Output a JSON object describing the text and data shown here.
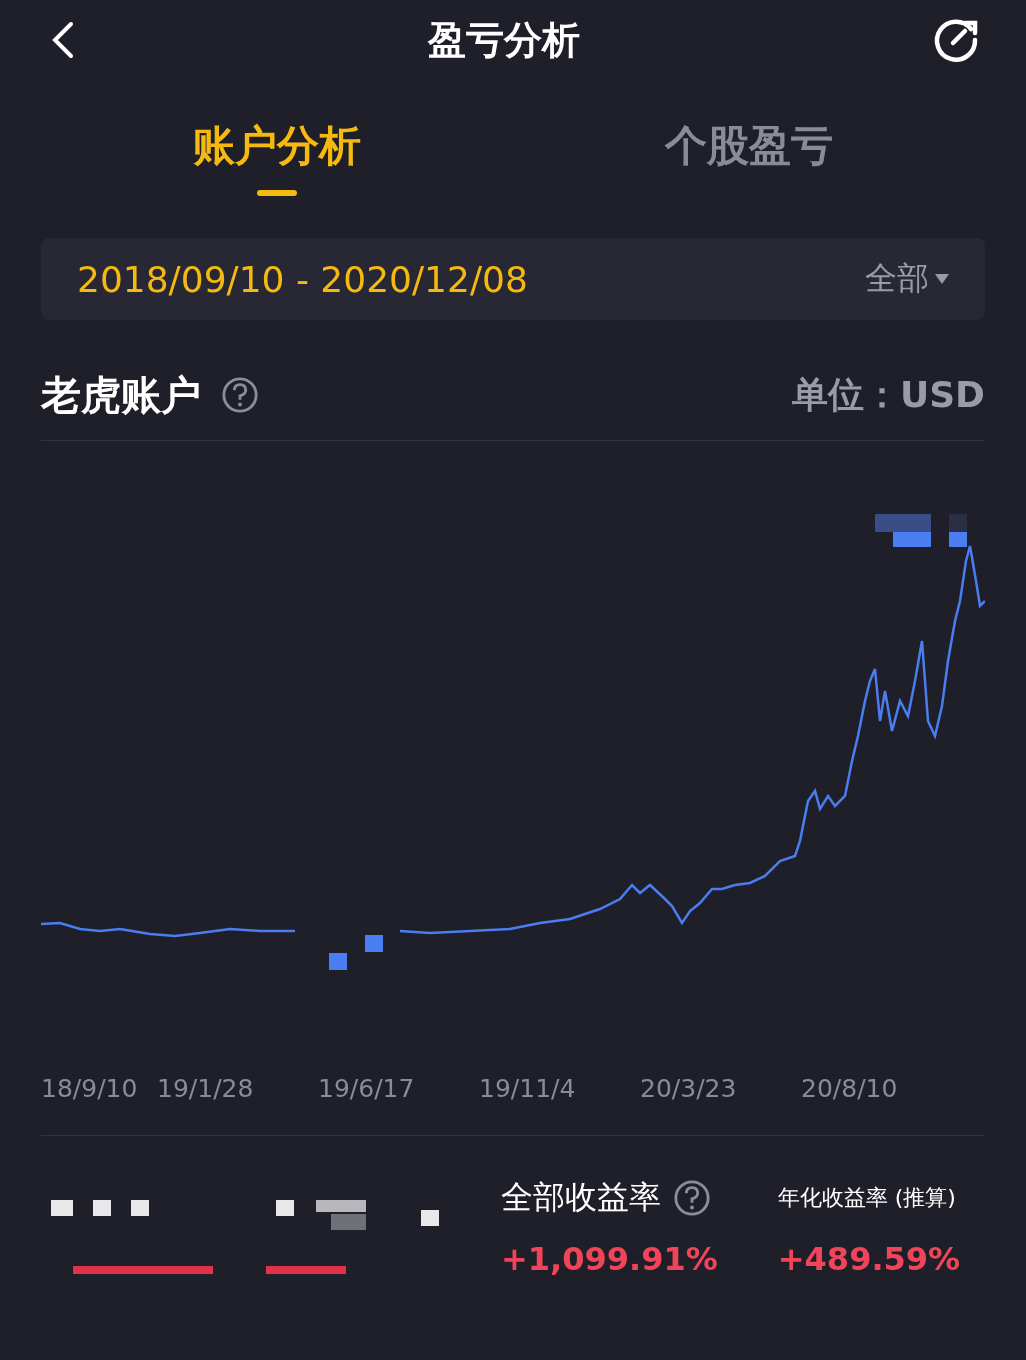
{
  "header": {
    "title": "盈亏分析"
  },
  "tabs": [
    {
      "label": "账户分析",
      "selected": true
    },
    {
      "label": "个股盈亏",
      "selected": false
    }
  ],
  "date_range": {
    "value": "2018/09/10 - 2020/12/08",
    "filter": "全部"
  },
  "account": {
    "name": "老虎账户",
    "unit": "单位：USD"
  },
  "chart": {
    "x_labels": [
      "18/9/10",
      "19/1/28",
      "19/6/17",
      "19/11/4",
      "20/3/23",
      "20/8/10"
    ]
  },
  "stats": [
    {
      "label": "全部收益率",
      "help": true,
      "value": "+1,099.91%"
    },
    {
      "label": "年化收益率 (推算)",
      "help": false,
      "value": "+489.59%"
    }
  ]
}
